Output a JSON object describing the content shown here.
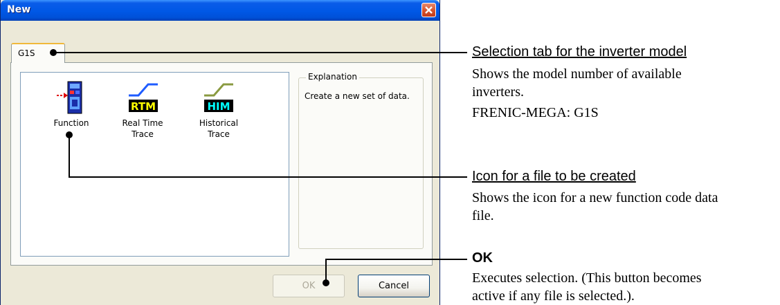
{
  "dialog": {
    "title": "New",
    "tab_label": "G1S",
    "items": [
      {
        "label_line1": "Function",
        "label_line2": "",
        "icon": "function-file-icon"
      },
      {
        "label_line1": "Real Time",
        "label_line2": "Trace",
        "icon": "rtm-icon",
        "badge": "RTM"
      },
      {
        "label_line1": "Historical",
        "label_line2": "Trace",
        "icon": "him-icon",
        "badge": "HIM"
      }
    ],
    "explanation": {
      "legend": "Explanation",
      "text": "Create a new set of data."
    },
    "buttons": {
      "ok_label": "OK",
      "cancel_label": "Cancel"
    }
  },
  "annotations": {
    "tab": {
      "title": "Selection tab for the inverter model",
      "body_lines": [
        "Shows the model number of available",
        "inverters.",
        "FRENIC-MEGA: G1S"
      ]
    },
    "icon": {
      "title": "Icon for a file to be created",
      "body_lines": [
        "Shows the icon for a new function code data",
        "file."
      ]
    },
    "ok": {
      "title": "OK",
      "body_lines": [
        "Executes selection. (This button becomes",
        "active if any file is selected.)."
      ]
    }
  },
  "colors": {
    "titlebar": "#0058e6",
    "rtm_badge_text": "#ffff00",
    "him_badge_text": "#00ffff",
    "rtm_line": "#1f5cff",
    "him_line": "#8a9a40"
  }
}
